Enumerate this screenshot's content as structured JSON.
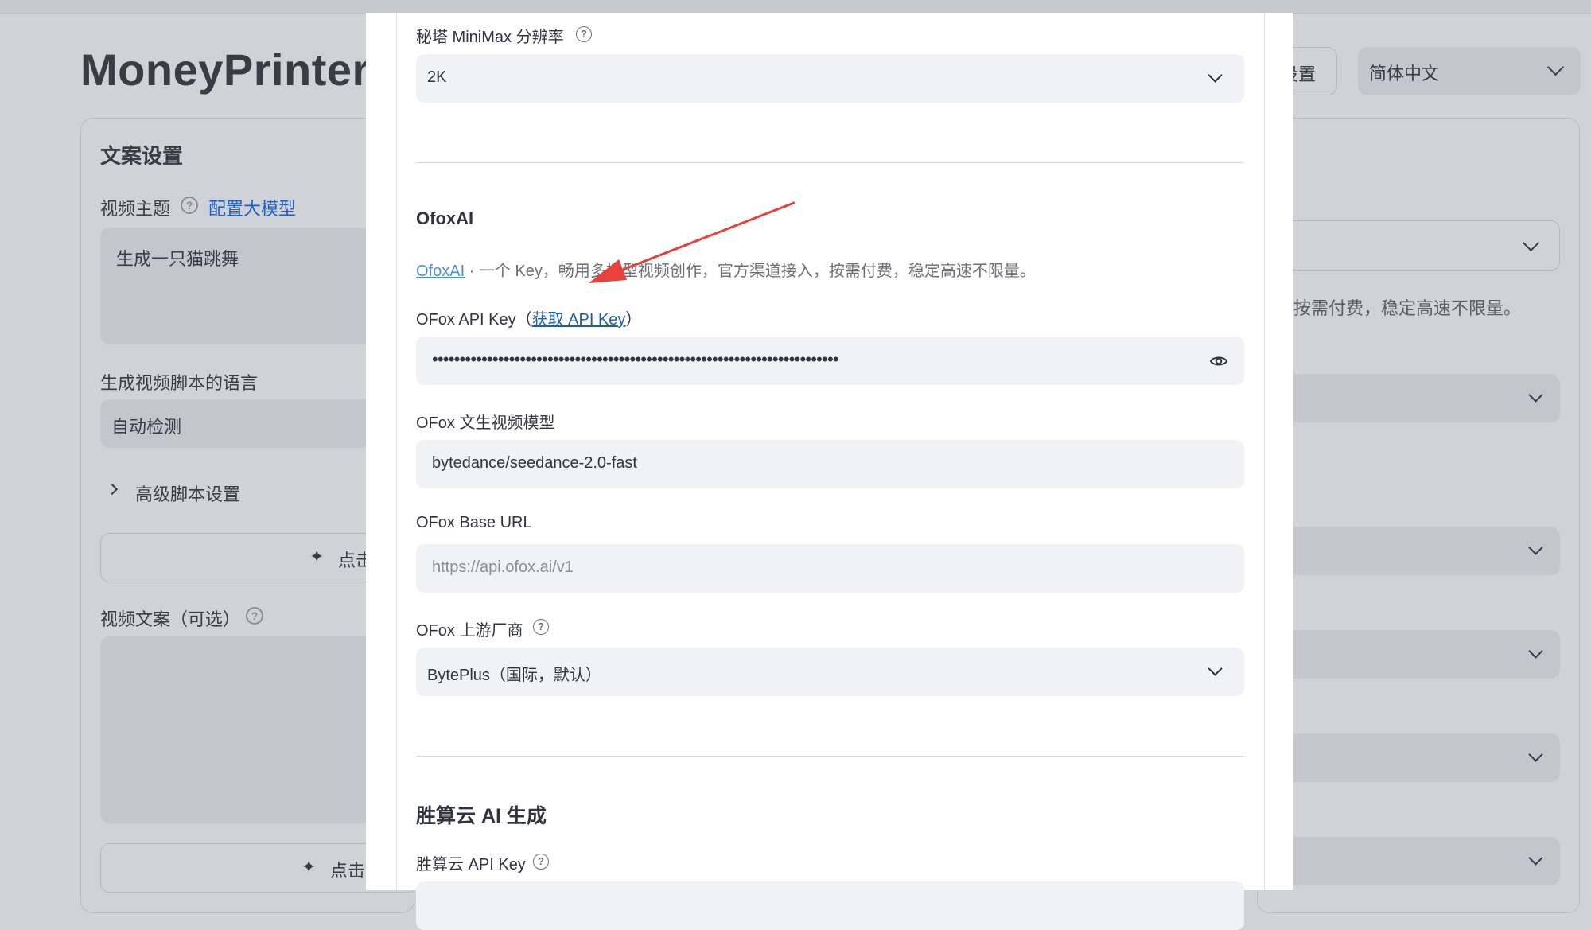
{
  "app": {
    "title": "MoneyPrinterT",
    "settings_button_label": "设置",
    "language_select_value": "简体中文"
  },
  "left_panel": {
    "heading": "文案设置",
    "video_subject_label": "视频主题",
    "config_llm_link": "配置大模型",
    "video_subject_value": "生成一只猫跳舞",
    "script_language_label": "生成视频脚本的语言",
    "script_language_value": "自动检测",
    "advanced_script_settings": "高级脚本设置",
    "generate_script_button": "点击",
    "video_script_label": "视频文案（可选）",
    "generate_terms_button": "点击"
  },
  "right_bg": {
    "caption_fragment": "按需付费，稳定高速不限量。"
  },
  "modal": {
    "minimax_resolution_label": "秘塔 MiniMax 分辨率",
    "minimax_resolution_value": "2K",
    "ofox_heading": "OfoxAI",
    "ofox_caption_link": "OfoxAI",
    "ofox_caption_text": " · 一个 Key，畅用多模型视频创作，官方渠道接入，按需付费，稳定高速不限量。",
    "ofox_api_key_label_prefix": "OFox API Key（",
    "ofox_api_key_link": "获取 API Key",
    "ofox_api_key_label_suffix": "）",
    "ofox_api_key_masked": "••••••••••••••••••••••••••••••••••••••••••••••••••••••••••••••••••••••••••",
    "ofox_model_label": "OFox 文生视频模型",
    "ofox_model_value": "bytedance/seedance-2.0-fast",
    "ofox_base_url_label": "OFox Base URL",
    "ofox_base_url_placeholder": "https://api.ofox.ai/v1",
    "ofox_vendor_label": "OFox 上游厂商",
    "ofox_vendor_value": "BytePlus（国际，默认）",
    "shengsuanyun_heading": "胜算云 AI 生成",
    "shengsuanyun_api_key_label": "胜算云 API Key"
  },
  "colors": {
    "backdrop": "#cfd2d7",
    "modal_bg": "#ffffff",
    "field_bg": "#f0f2f6",
    "link": "#1b5fa8",
    "annotation_arrow": "#e8413b"
  },
  "icons": [
    "help-icon",
    "chevron-down-icon",
    "chevron-right-icon",
    "eye-icon",
    "sparkle-icon"
  ]
}
